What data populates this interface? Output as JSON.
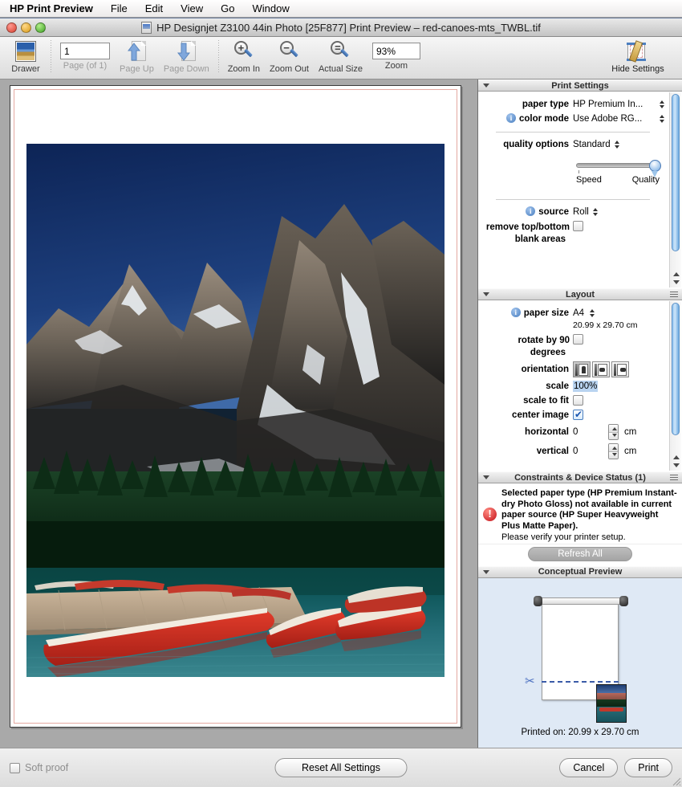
{
  "menubar": {
    "app_name": "HP Print Preview",
    "items": [
      "File",
      "Edit",
      "View",
      "Go",
      "Window"
    ]
  },
  "window": {
    "title": "HP Designjet Z3100 44in Photo [25F877] Print Preview – red-canoes-mts_TWBL.tif"
  },
  "toolbar": {
    "drawer_label": "Drawer",
    "page_value": "1",
    "page_label": "Page (of 1)",
    "page_up_label": "Page Up",
    "page_down_label": "Page Down",
    "zoom_in_label": "Zoom In",
    "zoom_out_label": "Zoom Out",
    "actual_size_label": "Actual Size",
    "zoom_value": "93%",
    "zoom_label": "Zoom",
    "hide_settings_label": "Hide Settings"
  },
  "print_settings": {
    "section_title": "Print Settings",
    "paper_type_label": "paper type",
    "paper_type_value": "HP Premium In...",
    "color_mode_label": "color mode",
    "color_mode_value": "Use Adobe RG...",
    "quality_options_label": "quality options",
    "quality_options_value": "Standard",
    "slider_min_label": "Speed",
    "slider_max_label": "Quality",
    "source_label": "source",
    "source_value": "Roll",
    "remove_blank_label": "remove top/bottom blank areas",
    "remove_blank_checked": false
  },
  "layout": {
    "section_title": "Layout",
    "paper_size_label": "paper size",
    "paper_size_value": "A4",
    "paper_dimensions": "20.99 x 29.70 cm",
    "rotate_label": "rotate by 90 degrees",
    "rotate_checked": false,
    "orientation_label": "orientation",
    "scale_label": "scale",
    "scale_value": "100%",
    "scale_to_fit_label": "scale to fit",
    "scale_to_fit_checked": false,
    "center_image_label": "center image",
    "center_image_checked": true,
    "horizontal_label": "horizontal",
    "horizontal_value": "0",
    "horizontal_unit": "cm",
    "vertical_label": "vertical",
    "vertical_value": "0",
    "vertical_unit": "cm"
  },
  "constraints": {
    "section_title": "Constraints & Device Status (1)",
    "message_bold": "Selected paper type (HP Premium Instant-dry Photo Gloss) not available in current paper source (HP Super Heavyweight Plus Matte Paper).",
    "message_plain": "Please verify your printer setup.",
    "refresh_label": "Refresh All"
  },
  "conceptual_preview": {
    "section_title": "Conceptual Preview",
    "printed_on": "Printed on: 20.99 x 29.70 cm"
  },
  "bottombar": {
    "soft_proof_label": "Soft proof",
    "soft_proof_checked": false,
    "reset_label": "Reset All Settings",
    "cancel_label": "Cancel",
    "print_label": "Print"
  },
  "colors": {
    "accent": "#4a7fc0",
    "error": "#c4111a",
    "panel_bg": "#dfe9f5",
    "highlight": "#b9d4f0"
  }
}
